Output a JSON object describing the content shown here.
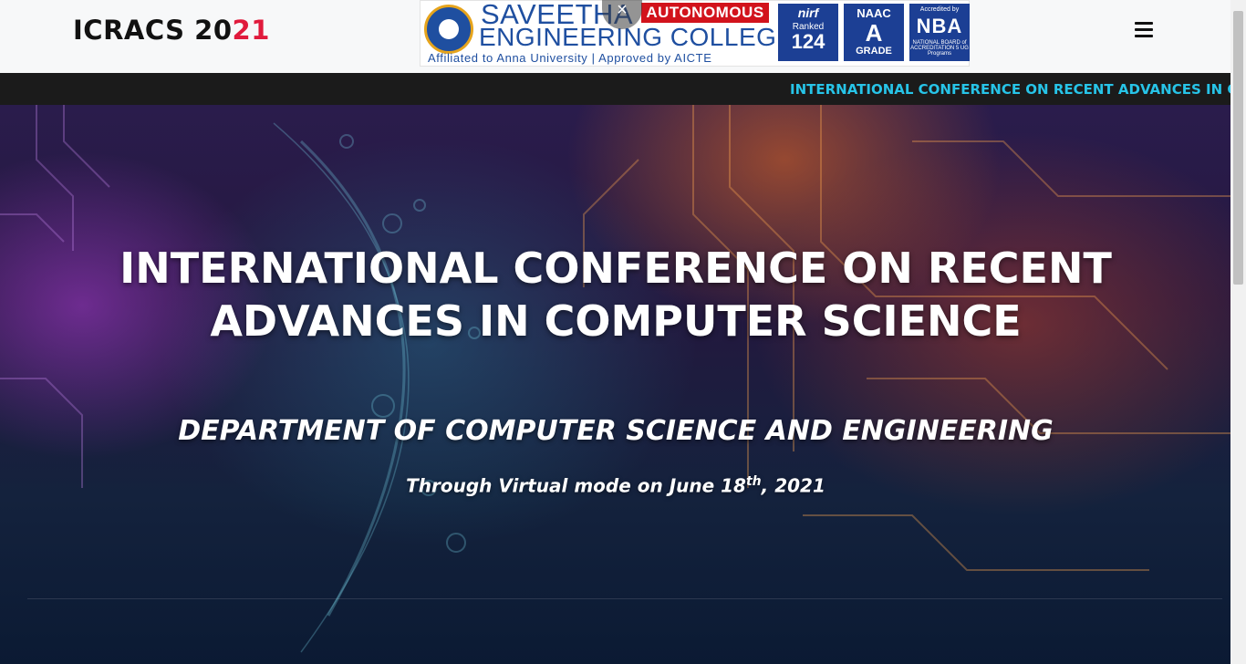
{
  "header": {
    "brand_prefix": "ICRACS 20",
    "brand_accent": "21",
    "accent_color": "#e01a3c"
  },
  "college": {
    "name_line1": "SAVEETHA",
    "autonomous": "AUTONOMOUS",
    "name_line2": "ENGINEERING COLLEGE",
    "tagline": "Affiliated to Anna University | Approved by AICTE",
    "close_icon": "×",
    "badges": {
      "nirf_title": "nirf",
      "nirf_ranked": "Ranked",
      "nirf_rank": "124",
      "naac_title": "NAAC",
      "naac_grade": "A",
      "naac_label": "GRADE",
      "nba_top": "Accredited by",
      "nba_logo": "NBA",
      "nba_bottom": "NATIONAL BOARD of ACCREDITATION 5 UG Programs"
    }
  },
  "menu": {
    "icon": "hamburger-menu-icon"
  },
  "ticker": {
    "text": "INTERNATIONAL CONFERENCE ON RECENT ADVANCES IN COMPUTER SCIENCE",
    "color": "#27c4e8"
  },
  "hero": {
    "title": "INTERNATIONAL CONFERENCE ON RECENT ADVANCES IN COMPUTER SCIENCE",
    "department": "DEPARTMENT OF COMPUTER SCIENCE AND ENGINEERING",
    "date_prefix": "Through Virtual mode on June 18",
    "date_sup": "th",
    "date_suffix": ", 2021"
  }
}
